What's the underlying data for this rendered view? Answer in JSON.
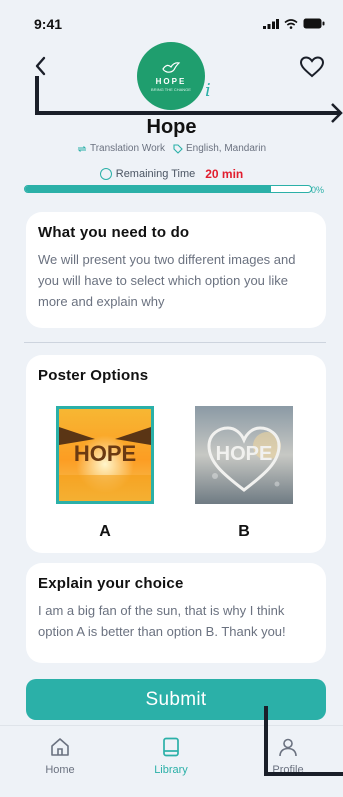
{
  "status_bar": {
    "time": "9:41"
  },
  "header": {
    "logo_word": "HOPE",
    "logo_sub": "BRING THE CHANGE",
    "info_glyph": "i",
    "title": "Hope",
    "category": "Translation Work",
    "languages": "English, Mandarin"
  },
  "timer": {
    "label": "Remaining Time",
    "value": "20 min"
  },
  "progress": {
    "percent_label": "0%",
    "fill_fraction": 0.86
  },
  "task": {
    "heading": "What you need to do",
    "body": "We will present you two different images and you will have to select which option you like more and explain why"
  },
  "posters": {
    "heading": "Poster Options",
    "options": [
      {
        "label": "A",
        "image_text": "HOPE",
        "selected": true
      },
      {
        "label": "B",
        "image_text": "HOPE",
        "selected": false
      }
    ]
  },
  "explain": {
    "heading": "Explain your choice",
    "text": "I am a big fan of the sun, that is why I think option A is better than option B. Thank you!"
  },
  "submit_label": "Submit",
  "tabs": [
    {
      "label": "Home",
      "icon": "home-icon"
    },
    {
      "label": "Library",
      "icon": "library-icon",
      "active": true
    },
    {
      "label": "Profile",
      "icon": "profile-icon"
    }
  ],
  "colors": {
    "accent": "#2bb0a8",
    "brand_green": "#1f9e6e",
    "urgent": "#e11d2e"
  }
}
